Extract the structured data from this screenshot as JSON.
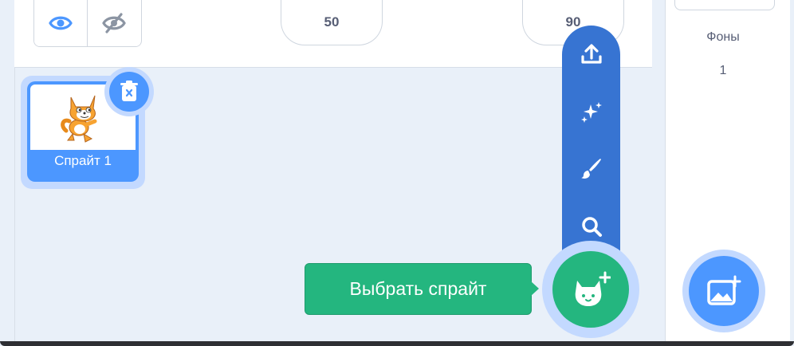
{
  "info": {
    "show_icon": "eye-icon",
    "hide_icon": "eye-slash-icon",
    "size_value": "50",
    "direction_value": "90"
  },
  "sprites": [
    {
      "name": "Спрайт 1",
      "icon": "cat-sprite-icon",
      "selected": true
    }
  ],
  "delete_icon": "trash-icon",
  "sprite_menu": {
    "items": [
      {
        "icon": "upload-icon"
      },
      {
        "icon": "surprise-icon"
      },
      {
        "icon": "paint-icon"
      },
      {
        "icon": "search-icon"
      }
    ]
  },
  "add_sprite": {
    "tooltip": "Выбрать спрайт",
    "icon": "cat-plus-icon"
  },
  "stage": {
    "backdrops_label": "Фоны",
    "backdrops_count": "1",
    "add_backdrop_icon": "image-plus-icon"
  },
  "colors": {
    "accent": "#4c97ff",
    "menu": "#3774d2",
    "green": "#24b67f",
    "halo": "#c3d9ff",
    "text": "#575e75"
  }
}
